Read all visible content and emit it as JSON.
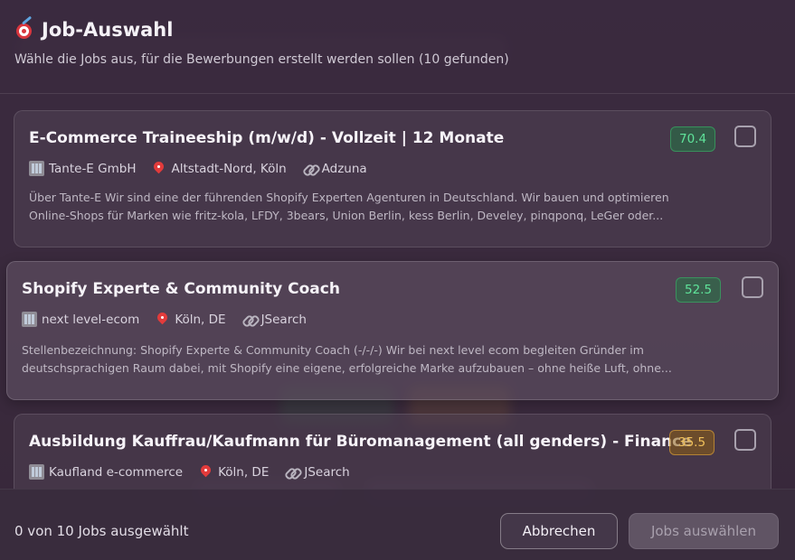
{
  "dialog": {
    "title": "Job-Auswahl",
    "subtitle": "Wähle die Jobs aus, für die Bewerbungen erstellt werden sollen (10 gefunden)"
  },
  "jobs": [
    {
      "title": "E-Commerce Traineeship (m/w/d) - Vollzeit | 12 Monate",
      "company": "Tante-E GmbH",
      "location": "Altstadt-Nord, Köln",
      "source": "Adzuna",
      "score": "70.4",
      "score_level": "green",
      "checked": false,
      "description_line1": "Über Tante-E Wir sind eine der führenden Shopify Experten Agenturen in Deutschland. Wir bauen und optimieren",
      "description_line2": "Online-Shops für Marken wie fritz-kola, LFDY, 3bears, Union Berlin, kess Berlin, Develey, pinqponq, LeGer oder..."
    },
    {
      "title": "Shopify Experte & Community Coach",
      "company": "next level-ecom",
      "location": "Köln, DE",
      "source": "JSearch",
      "score": "52.5",
      "score_level": "green",
      "checked": false,
      "description_line1": "Stellenbezeichnung: Shopify Experte & Community Coach (-/-/-) Wir bei next level ecom begleiten Gründer im",
      "description_line2": "deutschsprachigen Raum dabei, mit Shopify eine eigene, erfolgreiche Marke aufzubauen – ohne heiße Luft, ohne..."
    },
    {
      "title": "Ausbildung Kauffrau/Kaufmann für Büromanagement (all genders) - Finance",
      "company": "Kaufland e-commerce",
      "location": "Köln, DE",
      "source": "JSearch",
      "score": "35.5",
      "score_level": "amber",
      "checked": false
    }
  ],
  "footer": {
    "selection_count": "0 von 10 Jobs ausgewählt",
    "cancel_label": "Abbrechen",
    "confirm_label": "Jobs auswählen"
  },
  "icons": {
    "title": "target-icon",
    "company": "building-icon",
    "location": "pin-icon",
    "source": "link-icon"
  },
  "colors": {
    "score_green": "#5fe39a",
    "score_amber": "#f1c15a",
    "background": "#3a2c3d"
  }
}
